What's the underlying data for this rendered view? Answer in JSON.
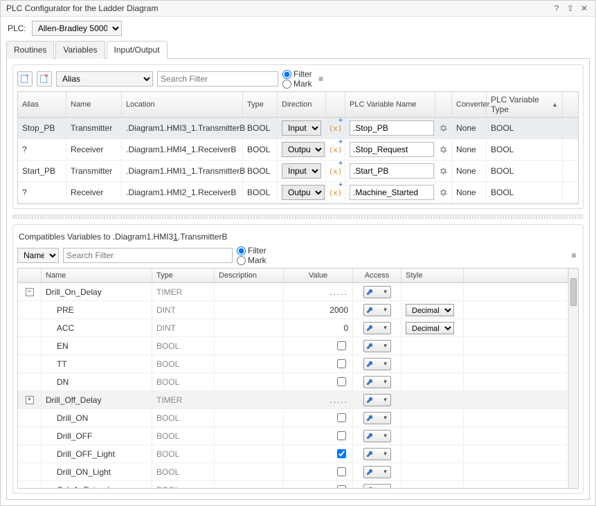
{
  "window": {
    "title": "PLC Configurator for the Ladder Diagram"
  },
  "plc": {
    "label": "PLC:",
    "selected": "Allen-Bradley 5000"
  },
  "tabs": {
    "routines": "Routines",
    "variables": "Variables",
    "io": "Input/Output"
  },
  "io": {
    "aliasDropdown": "Alias",
    "searchPlaceholder": "Search Filter",
    "filterLabel": "Filter",
    "markLabel": "Mark",
    "headers": {
      "alias": "Alias",
      "name": "Name",
      "location": "Location",
      "type": "Type",
      "direction": "Direction",
      "plcvar": "PLC Variable Name",
      "converter": "Converter",
      "plcvartype": "PLC Variable Type"
    },
    "rows": [
      {
        "alias": "Stop_PB",
        "name": "Transmitter",
        "location": ".Diagram1.HMI3_1.TransmitterB",
        "type": "BOOL",
        "direction": "Input",
        "plcvar": ".Stop_PB",
        "converter": "None",
        "ptype": "BOOL"
      },
      {
        "alias": "?",
        "name": "Receiver",
        "location": ".Diagram1.HMI4_1.ReceiverB",
        "type": "BOOL",
        "direction": "Output",
        "plcvar": ".Stop_Request",
        "converter": "None",
        "ptype": "BOOL"
      },
      {
        "alias": "Start_PB",
        "name": "Transmitter",
        "location": ".Diagram1.HMI1_1.TransmitterB",
        "type": "BOOL",
        "direction": "Input",
        "plcvar": ".Start_PB",
        "converter": "None",
        "ptype": "BOOL"
      },
      {
        "alias": "?",
        "name": "Receiver",
        "location": ".Diagram1.HMI2_1.ReceiverB",
        "type": "BOOL",
        "direction": "Output",
        "plcvar": ".Machine_Started",
        "converter": "None",
        "ptype": "BOOL"
      }
    ]
  },
  "compat": {
    "titlePrefix": "Compatibles Variables to .Diagram1.HMI3",
    "titleUnderline": "1",
    "titleSuffix": ".TransmitterB",
    "nameDropdown": "Name",
    "searchPlaceholder": "Search Filter",
    "filterLabel": "Filter",
    "markLabel": "Mark",
    "headers": {
      "name": "Name",
      "type": "Type",
      "description": "Description",
      "value": "Value",
      "access": "Access",
      "style": "Style"
    },
    "rows": [
      {
        "exp": "-",
        "name": "Drill_On_Delay",
        "type": "TIMER",
        "value": ".....",
        "access": true,
        "style": "",
        "indent": 0,
        "check": null
      },
      {
        "exp": "",
        "name": "PRE",
        "type": "DINT",
        "value": "2000",
        "access": true,
        "style": "Decimal",
        "indent": 1,
        "check": null
      },
      {
        "exp": "",
        "name": "ACC",
        "type": "DINT",
        "value": "0",
        "access": true,
        "style": "Decimal",
        "indent": 1,
        "check": null
      },
      {
        "exp": "",
        "name": "EN",
        "type": "BOOL",
        "value": "",
        "access": true,
        "style": "",
        "indent": 1,
        "check": false
      },
      {
        "exp": "",
        "name": "TT",
        "type": "BOOL",
        "value": "",
        "access": true,
        "style": "",
        "indent": 1,
        "check": false
      },
      {
        "exp": "",
        "name": "DN",
        "type": "BOOL",
        "value": "",
        "access": true,
        "style": "",
        "indent": 1,
        "check": false
      },
      {
        "exp": "+",
        "name": "Drill_Off_Delay",
        "type": "TIMER",
        "value": ".....",
        "access": true,
        "style": "",
        "indent": 0,
        "check": null,
        "hl": true
      },
      {
        "exp": "",
        "name": "Drill_ON",
        "type": "BOOL",
        "value": "",
        "access": true,
        "style": "",
        "indent": 1,
        "check": false
      },
      {
        "exp": "",
        "name": "Drill_OFF",
        "type": "BOOL",
        "value": "",
        "access": true,
        "style": "",
        "indent": 1,
        "check": false
      },
      {
        "exp": "",
        "name": "Drill_OFF_Light",
        "type": "BOOL",
        "value": "",
        "access": true,
        "style": "",
        "indent": 1,
        "check": true
      },
      {
        "exp": "",
        "name": "Drill_ON_Light",
        "type": "BOOL",
        "value": "",
        "access": true,
        "style": "",
        "indent": 1,
        "check": false
      },
      {
        "exp": "",
        "name": "Cyl_A_Extend",
        "type": "BOOL",
        "value": "",
        "access": true,
        "style": "",
        "indent": 1,
        "check": false
      }
    ]
  }
}
